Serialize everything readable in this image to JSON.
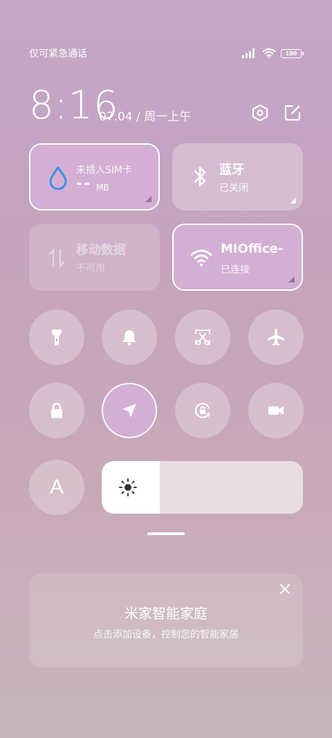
{
  "status_bar": {
    "carrier_text": "仅可紧急通话",
    "battery_level": "100",
    "icons": [
      "signal-icon",
      "wifi-icon",
      "battery-icon"
    ]
  },
  "header": {
    "time": "8:16",
    "date": "07.04 / 周一上午",
    "icons": [
      "settings-hexagon-icon",
      "edit-icon"
    ]
  },
  "tiles": {
    "data_usage": {
      "title": "未插入SIM卡",
      "value": "--",
      "unit": "MB",
      "icon": "droplet-icon",
      "active": true
    },
    "bluetooth": {
      "title": "蓝牙",
      "status": "已关闭",
      "icon": "bluetooth-icon",
      "active": false
    },
    "mobile_data": {
      "title": "移动数据",
      "status": "不可用",
      "icon": "mobile-data-arrows-icon",
      "active": false,
      "disabled": true
    },
    "wifi": {
      "title": "MIOffice-",
      "status": "已连接",
      "icon": "wifi-icon",
      "active": true
    }
  },
  "toggles_row1": [
    {
      "name": "flashlight",
      "icon": "flashlight-icon",
      "active": false
    },
    {
      "name": "ring",
      "icon": "bell-icon",
      "active": false
    },
    {
      "name": "screenshot",
      "icon": "scissors-screenshot-icon",
      "active": false
    },
    {
      "name": "airplane",
      "icon": "airplane-icon",
      "active": false
    }
  ],
  "toggles_row2": [
    {
      "name": "lock",
      "icon": "lock-icon",
      "active": false
    },
    {
      "name": "location",
      "icon": "location-arrow-icon",
      "active": true
    },
    {
      "name": "rotation-lock",
      "icon": "rotation-lock-icon",
      "active": false
    },
    {
      "name": "screen-record",
      "icon": "video-camera-icon",
      "active": false
    }
  ],
  "auto_brightness": {
    "label": "A",
    "active": false
  },
  "brightness": {
    "level": 0.29,
    "icon": "sun-icon"
  },
  "smart_home_card": {
    "title": "米家智能家庭",
    "subtitle": "点击添加设备，控制您的智能家居",
    "close_icon": "close-icon"
  },
  "colors": {
    "active_tile": "#d3afd3",
    "droplet": "#3d8fe8",
    "tile": "rgba(255,255,255,0.28)"
  }
}
